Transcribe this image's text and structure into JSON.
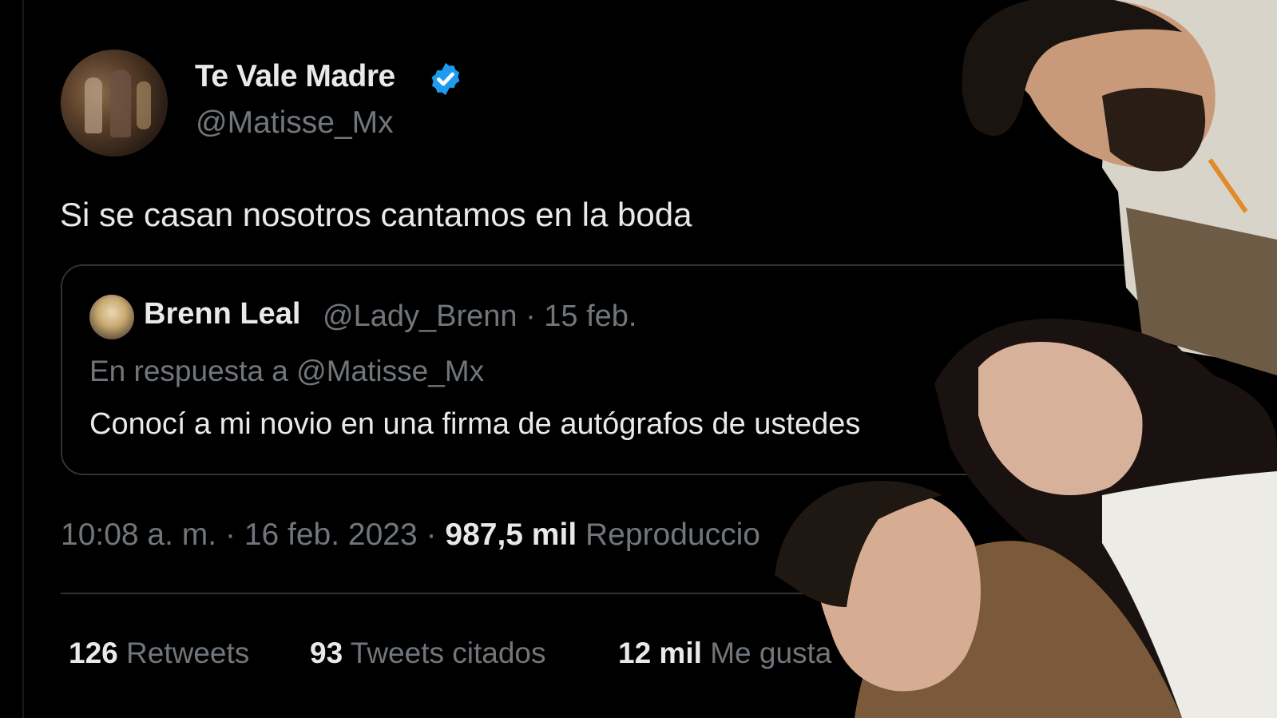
{
  "tweet": {
    "display_name": "Te Vale Madre",
    "handle": "@Matisse_Mx",
    "text": "Si se casan nosotros cantamos en la boda",
    "time": "10:08 a. m.",
    "date": "16 feb. 2023",
    "views_count": "987,5 mil",
    "views_label": "Reproduccio",
    "sep": "·"
  },
  "quote": {
    "display_name": "Brenn Leal",
    "handle_date": "@Lady_Brenn · 15 feb.",
    "reply_to": "En respuesta a @Matisse_Mx",
    "text": "Conocí a mi novio en una firma de autógrafos de ustedes"
  },
  "stats": {
    "retweets_count": "126",
    "retweets_label": "Retweets",
    "quotes_count": "93",
    "quotes_label": "Tweets citados",
    "likes_count": "12 mil",
    "likes_label": "Me gusta"
  },
  "colors": {
    "background": "#000000",
    "text": "#e7e9ea",
    "muted": "#71767b",
    "verified": "#1d9bf0",
    "border": "#2f3336"
  },
  "icons": {
    "verified": "verified-badge-icon"
  }
}
